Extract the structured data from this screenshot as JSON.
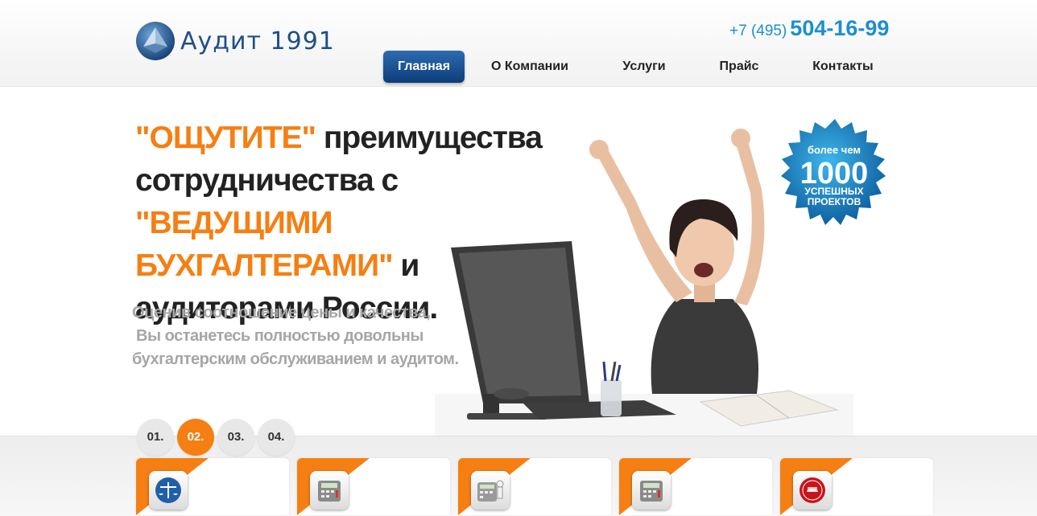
{
  "header": {
    "logo_text": "Аудит 1991",
    "phone_code": "+7 (495)",
    "phone_number": "504-16-99"
  },
  "nav": {
    "items": [
      {
        "label": "Главная",
        "active": true
      },
      {
        "label": "О Компании",
        "active": false
      },
      {
        "label": "Услуги",
        "active": false
      },
      {
        "label": "Прайс",
        "active": false
      },
      {
        "label": "Контакты",
        "active": false
      }
    ]
  },
  "hero": {
    "headline_parts": [
      "\"ОЩУТИТЕ\"",
      " преимущества сотрудничества с ",
      "\"ВЕДУЩИМИ БУХГАЛТЕРАМИ\"",
      " и аудиторами России."
    ],
    "subtext_lines": [
      "Оценив соотношение цены и качества,",
      " Вы останетесь полностью довольны",
      "бухгалтерским обслуживанием и аудитом."
    ],
    "badge": {
      "line1": "более чем",
      "number": "1000",
      "line3": "УСПЕШНЫХ",
      "line4": "ПРОЕКТОВ"
    }
  },
  "slider": {
    "steps": [
      "01.",
      "02.",
      "03.",
      "04."
    ],
    "active_step": "02."
  },
  "cards": [
    {
      "icon": "scales-icon"
    },
    {
      "icon": "calculator-icon"
    },
    {
      "icon": "calculator-figure-icon"
    },
    {
      "icon": "calculator-icon"
    },
    {
      "icon": "sale-icon"
    }
  ],
  "colors": {
    "accent_orange": "#f57f12",
    "nav_active_blue": "#0d3d7a",
    "phone_blue": "#1b8fd1",
    "logo_blue": "#1d4f86"
  }
}
